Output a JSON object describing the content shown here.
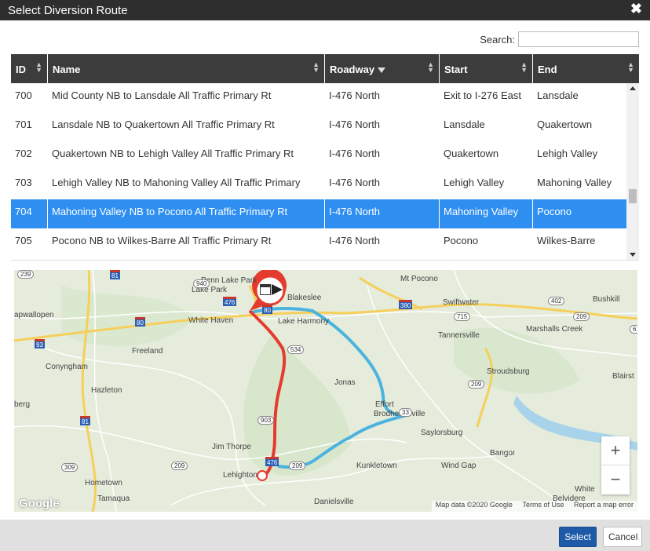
{
  "dialog": {
    "title": "Select Diversion Route",
    "close_icon": "close-icon"
  },
  "search": {
    "label": "Search:",
    "value": "",
    "placeholder": ""
  },
  "table": {
    "columns": [
      "ID",
      "Name",
      "Roadway",
      "Start",
      "End"
    ],
    "filter_column": "Roadway",
    "rows": [
      {
        "id": "700",
        "name": "Mid County NB to Lansdale All Traffic Primary Rt",
        "roadway": "I-476 North",
        "start": "Exit to I-276 East",
        "end": "Lansdale"
      },
      {
        "id": "701",
        "name": "Lansdale NB to Quakertown All Traffic Primary Rt",
        "roadway": "I-476 North",
        "start": "Lansdale",
        "end": "Quakertown"
      },
      {
        "id": "702",
        "name": "Quakertown NB to Lehigh Valley All Traffic Primary Rt",
        "roadway": "I-476 North",
        "start": "Quakertown",
        "end": "Lehigh Valley"
      },
      {
        "id": "703",
        "name": "Lehigh Valley NB to Mahoning Valley All Traffic Primary",
        "roadway": "I-476 North",
        "start": "Lehigh Valley",
        "end": "Mahoning Valley"
      },
      {
        "id": "704",
        "name": "Mahoning Valley NB to Pocono All Traffic Primary Rt",
        "roadway": "I-476 North",
        "start": "Mahoning Valley",
        "end": "Pocono"
      },
      {
        "id": "705",
        "name": "Pocono NB to Wilkes-Barre All Traffic Primary Rt",
        "roadway": "I-476 North",
        "start": "Pocono",
        "end": "Wilkes-Barre"
      }
    ],
    "selected_id": "704",
    "selected_color": "#2f8ff0"
  },
  "map": {
    "places": [
      "Penn Lake Park",
      "Lake Park",
      "Blakeslee",
      "Mt Pocono",
      "Swiftwater",
      "Bushkill",
      "apwallopen",
      "White Haven",
      "Lake Harmony",
      "Marshalls Creek",
      "Tannersville",
      "Freeland",
      "Conyngham",
      "Stroudsburg",
      "Blairst",
      "Hazleton",
      "Jonas",
      "Effort",
      "Brodheadsville",
      "Saylorsburg",
      "Jim Thorpe",
      "Bangor",
      "Kunkletown",
      "Wind Gap",
      "Lehighton",
      "Hometown",
      "Tamaqua",
      "Danielsville",
      "Belvidere",
      "White",
      "berg"
    ],
    "route_shields": [
      "239",
      "81",
      "476",
      "80",
      "940",
      "380",
      "402",
      "715",
      "209",
      "80",
      "534",
      "611",
      "93",
      "209",
      "81",
      "903",
      "209",
      "309",
      "33",
      "476",
      "209"
    ],
    "primary_route_color": "#e53b2f",
    "alt_route_color": "#4bb3de",
    "marker_icon": "calendar-arrow-icon",
    "zoom_in": "+",
    "zoom_out": "−",
    "logo": "Google",
    "attribution": [
      "Map data ©2020 Google",
      "Terms of Use",
      "Report a map error"
    ]
  },
  "footer": {
    "select_label": "Select",
    "cancel_label": "Cancel"
  }
}
